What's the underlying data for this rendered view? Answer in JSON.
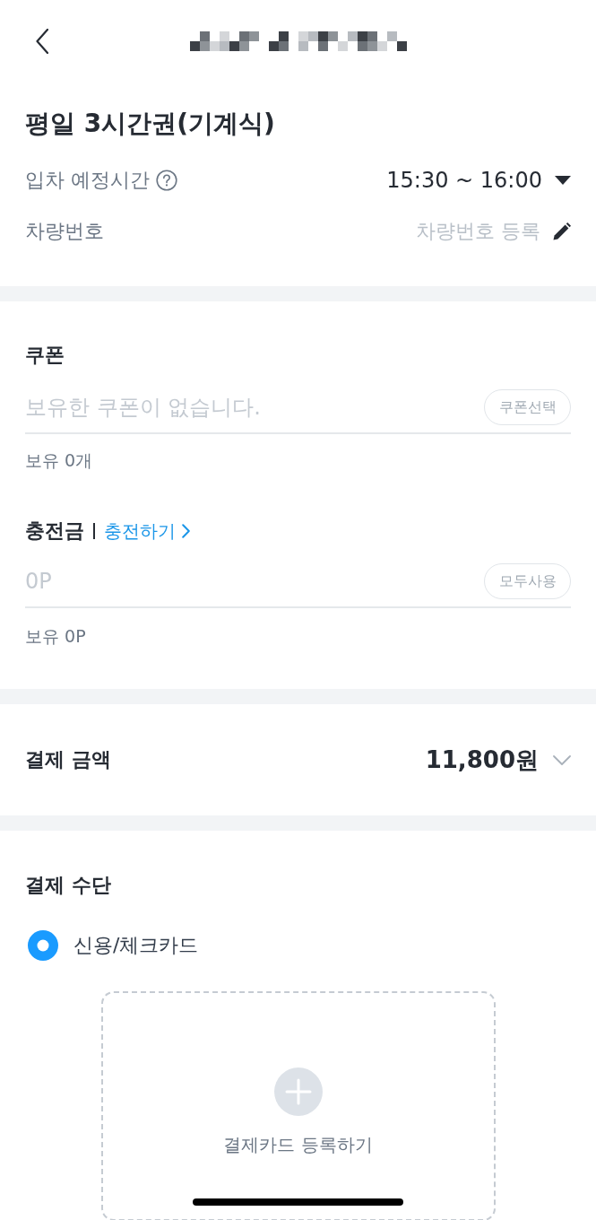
{
  "product": {
    "title": "평일 3시간권(기계식)"
  },
  "details": [
    {
      "kind": "select",
      "label": "입차 예정시간",
      "help": true,
      "value": "15:30 ~ 16:00"
    },
    {
      "kind": "edit",
      "label": "차량번호",
      "help": false,
      "action_label": "차량번호 등록"
    }
  ],
  "coupon": {
    "title": "쿠폰",
    "placeholder": "보유한 쿠폰이 없습니다.",
    "button": "쿠폰선택",
    "balance": "보유 0개"
  },
  "points": {
    "title": "충전금",
    "link": "충전하기",
    "placeholder": "0P",
    "button": "모두사용",
    "balance": "보유 0P"
  },
  "payment_amount": {
    "label": "결제 금액",
    "value": "11,800원",
    "expanded": false
  },
  "payment_method": {
    "title": "결제 수단",
    "options": [
      {
        "label": "신용/체크카드",
        "selected": true
      }
    ],
    "add_card": {
      "label": "결제카드 등록하기"
    }
  }
}
